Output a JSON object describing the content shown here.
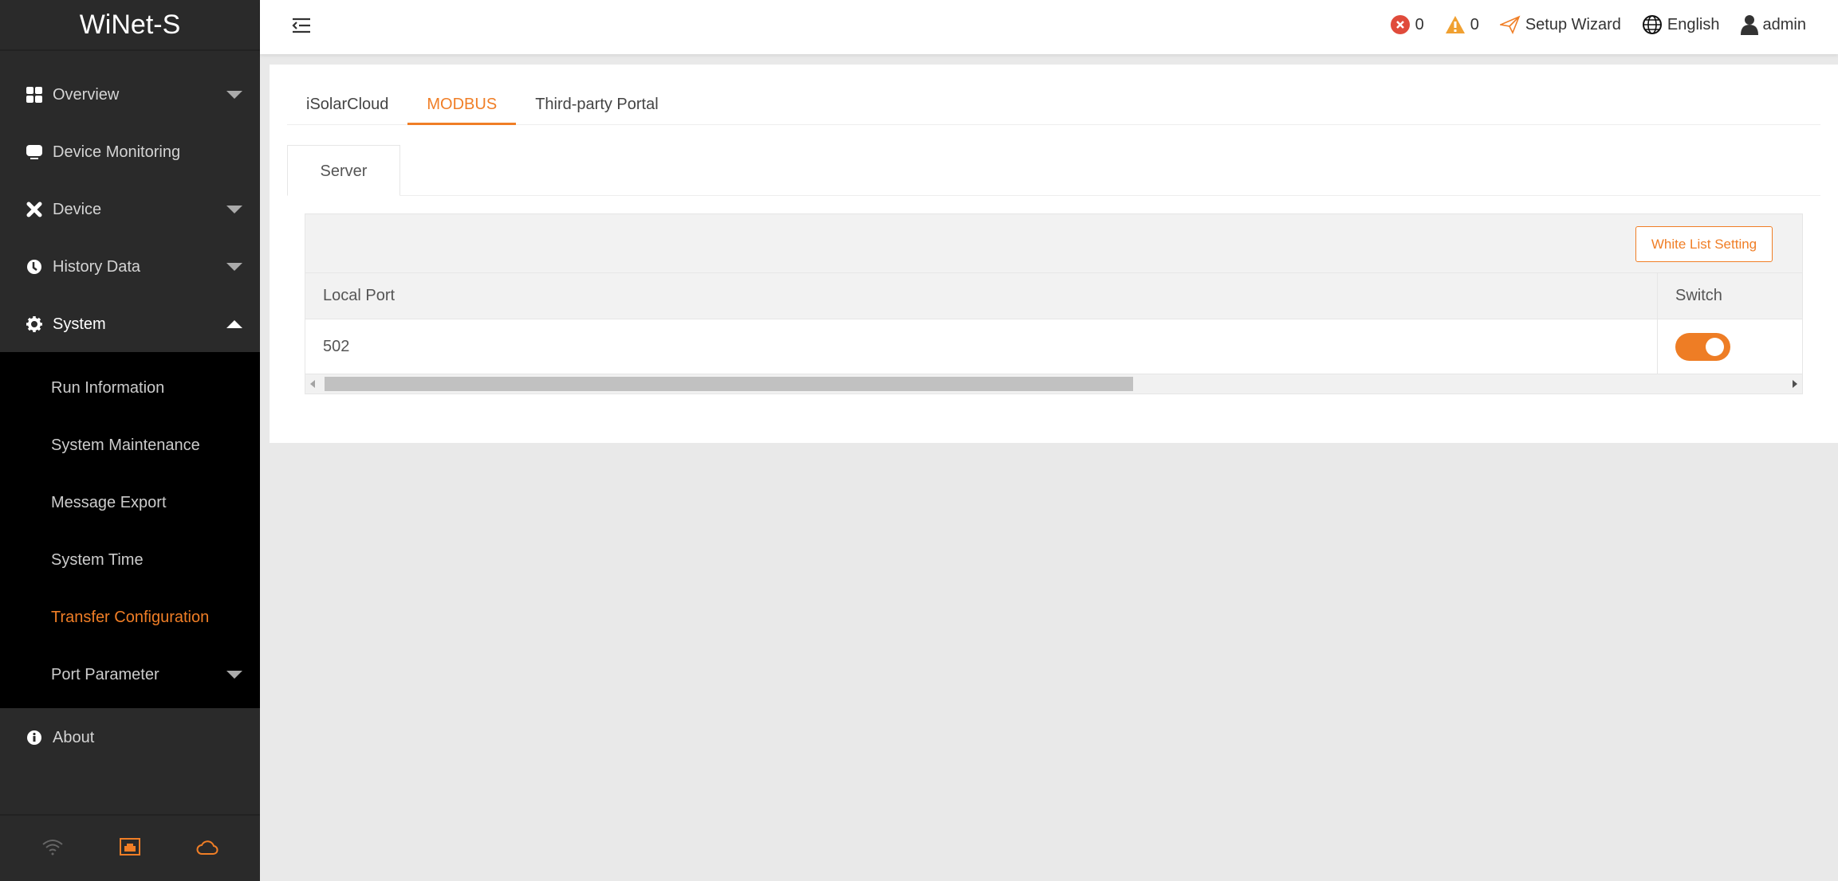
{
  "app": {
    "title": "WiNet-S"
  },
  "sidebar": {
    "items": [
      {
        "label": "Overview",
        "icon": "grid-icon"
      },
      {
        "label": "Device Monitoring",
        "icon": "monitor-icon"
      },
      {
        "label": "Device",
        "icon": "tools-icon"
      },
      {
        "label": "History Data",
        "icon": "clock-icon"
      },
      {
        "label": "System",
        "icon": "gear-icon"
      }
    ],
    "submenu": [
      "Run Information",
      "System Maintenance",
      "Message Export",
      "System Time",
      "Transfer Configuration",
      "Port Parameter"
    ],
    "selected": "Transfer Configuration",
    "about": "About",
    "footer_icons": [
      "wifi-icon",
      "ethernet-icon",
      "cloud-icon"
    ]
  },
  "header": {
    "error_count": "0",
    "warning_count": "0",
    "setup_wizard": "Setup Wizard",
    "language": "English",
    "user": "admin"
  },
  "main": {
    "tabs": [
      "iSolarCloud",
      "MODBUS",
      "Third-party Portal"
    ],
    "active_tab": "MODBUS",
    "subtabs": [
      "Server"
    ],
    "white_list_button": "White List Setting",
    "table": {
      "columns": [
        "Local Port",
        "Switch"
      ],
      "rows": [
        {
          "local_port": "502",
          "switch_on": true
        }
      ]
    }
  },
  "colors": {
    "accent": "#f07e26",
    "sidebar": "#2a2a2a",
    "error": "#e04b3b",
    "warning": "#f0a030"
  }
}
